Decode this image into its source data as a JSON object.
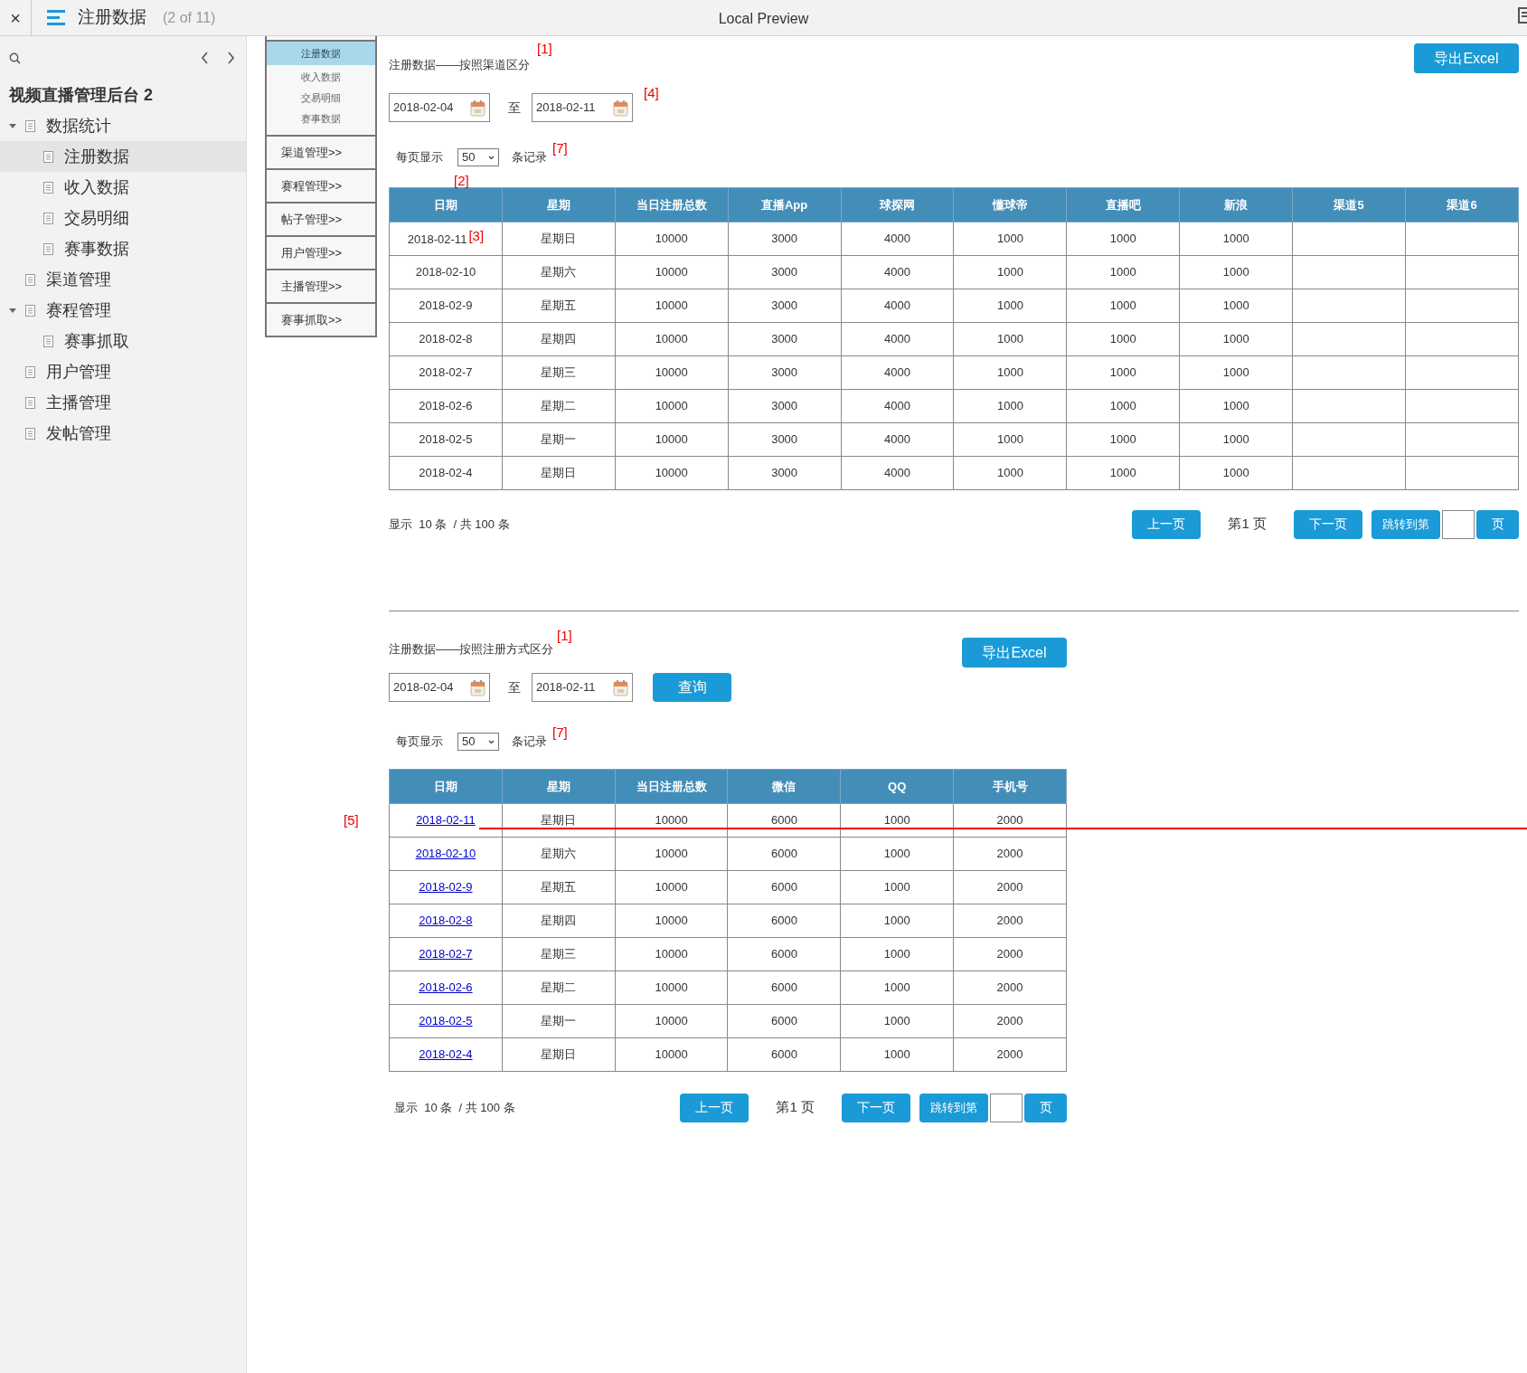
{
  "topbar": {
    "close": "×",
    "title": "注册数据",
    "page_count": "(2 of 11)",
    "preview_label": "Local Preview"
  },
  "sidebar": {
    "project": "视频直播管理后台 2",
    "tree": [
      {
        "label": "数据统计",
        "expanded": true,
        "selected": false,
        "children": [
          {
            "label": "注册数据",
            "selected": true
          },
          {
            "label": "收入数据",
            "selected": false
          },
          {
            "label": "交易明细",
            "selected": false
          },
          {
            "label": "赛事数据",
            "selected": false
          }
        ]
      },
      {
        "label": "渠道管理",
        "selected": false
      },
      {
        "label": "赛程管理",
        "expanded": true,
        "selected": false,
        "children": [
          {
            "label": "赛事抓取",
            "selected": false
          }
        ]
      },
      {
        "label": "用户管理",
        "selected": false
      },
      {
        "label": "主播管理",
        "selected": false
      },
      {
        "label": "发帖管理",
        "selected": false
      }
    ]
  },
  "proto_nav": {
    "submenu": [
      {
        "label": "注册数据",
        "selected": true
      },
      {
        "label": "收入数据",
        "selected": false
      },
      {
        "label": "交易明细",
        "selected": false
      },
      {
        "label": "赛事数据",
        "selected": false
      }
    ],
    "menus": [
      "渠道管理>>",
      "赛程管理>>",
      "帖子管理>>",
      "用户管理>>",
      "主播管理>>",
      "赛事抓取>>"
    ]
  },
  "sections": [
    {
      "title": "注册数据——按照渠道区分",
      "title_note": "[1]",
      "export": "导出Excel",
      "start": "2018-02-04",
      "separator": "至",
      "end": "2018-02-11",
      "date_note": "[4]",
      "per_page_label": "每页显示",
      "per_page_value": "50",
      "records_label": "条记录",
      "per_page_note": "[7]",
      "header_note": "[2]",
      "date_links": false,
      "columns": [
        "日期",
        "星期",
        "当日注册总数",
        "直播App",
        "球探网",
        "懂球帝",
        "直播吧",
        "新浪",
        "渠道5",
        "渠道6"
      ],
      "rows": [
        {
          "cells": [
            "2018-02-11",
            "星期日",
            "10000",
            "3000",
            "4000",
            "1000",
            "1000",
            "1000"
          ],
          "note": "[3]"
        },
        {
          "cells": [
            "2018-02-10",
            "星期六",
            "10000",
            "3000",
            "4000",
            "1000",
            "1000",
            "1000"
          ]
        },
        {
          "cells": [
            "2018-02-9",
            "星期五",
            "10000",
            "3000",
            "4000",
            "1000",
            "1000",
            "1000"
          ]
        },
        {
          "cells": [
            "2018-02-8",
            "星期四",
            "10000",
            "3000",
            "4000",
            "1000",
            "1000",
            "1000"
          ]
        },
        {
          "cells": [
            "2018-02-7",
            "星期三",
            "10000",
            "3000",
            "4000",
            "1000",
            "1000",
            "1000"
          ]
        },
        {
          "cells": [
            "2018-02-6",
            "星期二",
            "10000",
            "3000",
            "4000",
            "1000",
            "1000",
            "1000"
          ]
        },
        {
          "cells": [
            "2018-02-5",
            "星期一",
            "10000",
            "3000",
            "4000",
            "1000",
            "1000",
            "1000"
          ]
        },
        {
          "cells": [
            "2018-02-4",
            "星期日",
            "10000",
            "3000",
            "4000",
            "1000",
            "1000",
            "1000"
          ]
        }
      ],
      "summary": "显示  10 条  / 共 100 条",
      "prev": "上一页",
      "page_label": "第1 页",
      "next": "下一页",
      "jump": "跳转到第",
      "page_unit": "页"
    },
    {
      "title": "注册数据——按照注册方式区分",
      "title_note": "[1]",
      "export": "导出Excel",
      "start": "2018-02-04",
      "separator": "至",
      "end": "2018-02-11",
      "query": "查询",
      "per_page_label": "每页显示",
      "per_page_value": "50",
      "records_label": "条记录",
      "per_page_note": "[7]",
      "side_note": "[5]",
      "date_links": true,
      "columns": [
        "日期",
        "星期",
        "当日注册总数",
        "微信",
        "QQ",
        "手机号"
      ],
      "rows": [
        {
          "cells": [
            "2018-02-11",
            "星期日",
            "10000",
            "6000",
            "1000",
            "2000"
          ]
        },
        {
          "cells": [
            "2018-02-10",
            "星期六",
            "10000",
            "6000",
            "1000",
            "2000"
          ]
        },
        {
          "cells": [
            "2018-02-9",
            "星期五",
            "10000",
            "6000",
            "1000",
            "2000"
          ]
        },
        {
          "cells": [
            "2018-02-8",
            "星期四",
            "10000",
            "6000",
            "1000",
            "2000"
          ]
        },
        {
          "cells": [
            "2018-02-7",
            "星期三",
            "10000",
            "6000",
            "1000",
            "2000"
          ]
        },
        {
          "cells": [
            "2018-02-6",
            "星期二",
            "10000",
            "6000",
            "1000",
            "2000"
          ]
        },
        {
          "cells": [
            "2018-02-5",
            "星期一",
            "10000",
            "6000",
            "1000",
            "2000"
          ]
        },
        {
          "cells": [
            "2018-02-4",
            "星期日",
            "10000",
            "6000",
            "1000",
            "2000"
          ]
        }
      ],
      "summary": "显示  10 条  / 共 100 条",
      "prev": "上一页",
      "page_label": "第1 页",
      "next": "下一页",
      "jump": "跳转到第",
      "page_unit": "页"
    }
  ]
}
